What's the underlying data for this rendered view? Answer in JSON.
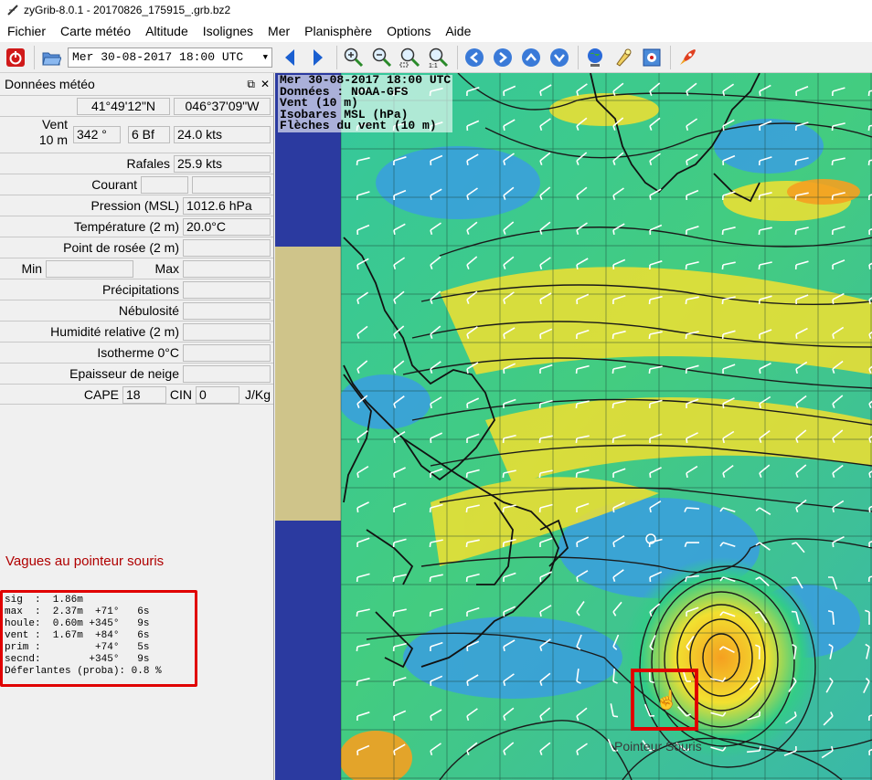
{
  "window": {
    "title": "zyGrib-8.0.1 - 20170826_175915_.grb.bz2"
  },
  "menu": [
    "Fichier",
    "Carte météo",
    "Altitude",
    "Isolignes",
    "Mer",
    "Planisphère",
    "Options",
    "Aide"
  ],
  "toolbar": {
    "date_value": "Mer 30-08-2017 18:00 UTC",
    "icons": [
      "power-icon",
      "open-file-icon",
      "prev-date-icon",
      "next-date-icon",
      "zoom-in-icon",
      "zoom-out-icon",
      "zoom-fit-icon",
      "zoom-actual-icon",
      "pan-left-icon",
      "pan-right-icon",
      "pan-up-icon",
      "pan-down-icon",
      "globe-icon",
      "bulb-icon",
      "gps-icon",
      "rocket-icon"
    ]
  },
  "panel": {
    "title": "Données météo",
    "lat": "41°49'12\"N",
    "lon": "046°37'09\"W",
    "wind_label_1": "Vent",
    "wind_label_2": "10 m",
    "wind_dir": "342 °",
    "wind_bf": "6 Bf",
    "wind_kts": "24.0  kts",
    "gust_label": "Rafales",
    "gust_value": "25.9  kts",
    "current_label": "Courant",
    "pressure_label": "Pression (MSL)",
    "pressure_value": "1012.6 hPa",
    "temp_label": "Température (2 m)",
    "temp_value": "20.0°C",
    "dewpoint_label": "Point de rosée (2 m)",
    "min_label": "Min",
    "max_label": "Max",
    "precip_label": "Précipitations",
    "cloud_label": "Nébulosité",
    "humidity_label": "Humidité relative (2 m)",
    "iso0_label": "Isotherme 0°C",
    "snow_label": "Epaisseur de neige",
    "cape_label": "CAPE",
    "cape_value": "18",
    "cin_label": "CIN",
    "cin_value": "0",
    "cape_unit": "J/Kg"
  },
  "waves": {
    "title": "Vagues au pointeur souris",
    "lines": [
      "sig  :  1.86m",
      "max  :  2.37m  +71°   6s",
      "houle:  0.60m +345°   9s",
      "vent :  1.67m  +84°   6s",
      "prim :         +74°   5s",
      "secnd:        +345°   9s",
      "Déferlantes (proba): 0.8 %"
    ]
  },
  "map": {
    "info_lines": [
      "Mer 30-08-2017 18:00 UTC",
      "Données : NOAA-GFS",
      "Vent (10 m)",
      "Isobares MSL (hPa)",
      "Flèches du vent (10 m)"
    ],
    "pointer_label": "Pointeur Souris",
    "colors": {
      "ocean_blue": "#2b3aa0",
      "land": "#cfc48a",
      "low_wind": "#3a9ee0",
      "mid_wind": "#33cc88",
      "high_wind": "#f2e030",
      "very_high_wind": "#f5a020"
    }
  }
}
